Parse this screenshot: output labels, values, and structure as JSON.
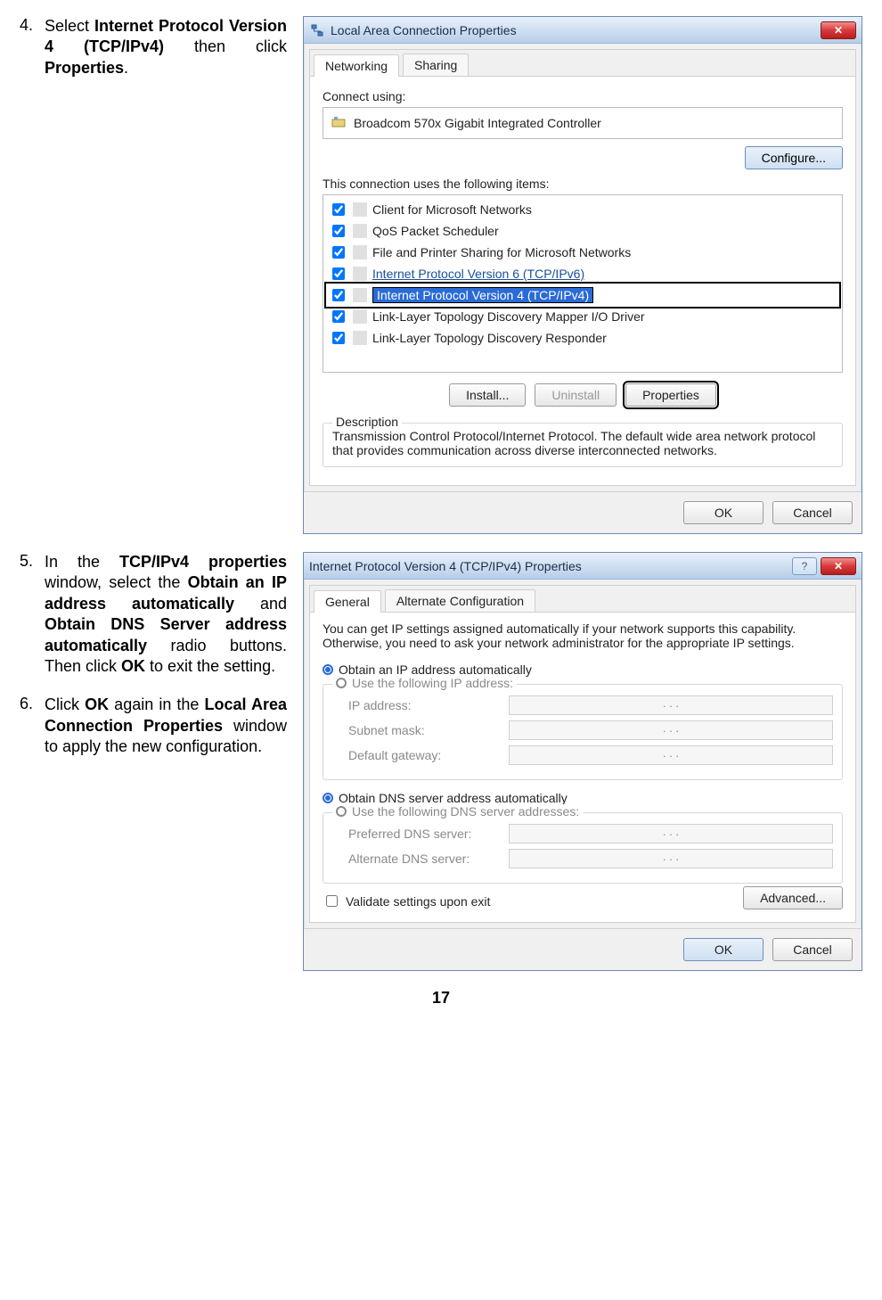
{
  "page_number": "17",
  "steps": {
    "s4": {
      "num": "4.",
      "t1": "Select ",
      "b1": "Internet Protocol Version 4 (TCP/IPv4)",
      "t2": " then click ",
      "b2": "Properties",
      "t3": "."
    },
    "s5": {
      "num": "5.",
      "t1": "In the ",
      "b1": "TCP/IPv4 properties",
      "t2": " window, select the ",
      "b2": "Obtain an IP address automatically",
      "t3": " and ",
      "b3": "Obtain DNS Server address automatically",
      "t4": " radio buttons. Then click ",
      "b4": "OK",
      "t5": " to exit the setting."
    },
    "s6": {
      "num": "6.",
      "t1": "Click ",
      "b1": "OK",
      "t2": " again in the ",
      "b2": "Local Area Connection Properties",
      "t3": " window to apply the new configuration."
    }
  },
  "win1": {
    "title": "Local Area Connection Properties",
    "tab_networking": "Networking",
    "tab_sharing": "Sharing",
    "connect_using": "Connect using:",
    "adapter": "Broadcom 570x Gigabit Integrated Controller",
    "configure": "Configure...",
    "items_label": "This connection uses the following items:",
    "items": [
      "Client for Microsoft Networks",
      "QoS Packet Scheduler",
      "File and Printer Sharing for Microsoft Networks",
      "Internet Protocol Version 6 (TCP/IPv6)",
      "Internet Protocol Version 4 (TCP/IPv4)",
      "Link-Layer Topology Discovery Mapper I/O Driver",
      "Link-Layer Topology Discovery Responder"
    ],
    "install": "Install...",
    "uninstall": "Uninstall",
    "properties": "Properties",
    "desc_title": "Description",
    "desc": "Transmission Control Protocol/Internet Protocol. The default wide area network protocol that provides communication across diverse interconnected networks.",
    "ok": "OK",
    "cancel": "Cancel"
  },
  "win2": {
    "title": "Internet Protocol Version 4 (TCP/IPv4) Properties",
    "tab_general": "General",
    "tab_alt": "Alternate Configuration",
    "intro": "You can get IP settings assigned automatically if your network supports this capability. Otherwise, you need to ask your network administrator for the appropriate IP settings.",
    "r1": "Obtain an IP address automatically",
    "r2": "Use the following IP address:",
    "ip_label": "IP address:",
    "subnet_label": "Subnet mask:",
    "gateway_label": "Default gateway:",
    "r3": "Obtain DNS server address automatically",
    "r4": "Use the following DNS server addresses:",
    "pref_dns": "Preferred DNS server:",
    "alt_dns": "Alternate DNS server:",
    "validate": "Validate settings upon exit",
    "advanced": "Advanced...",
    "ok": "OK",
    "cancel": "Cancel",
    "ip_dots": ".       .       ."
  }
}
